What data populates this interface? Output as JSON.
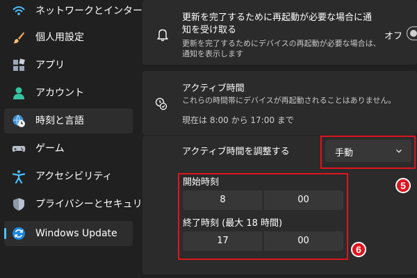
{
  "sidebar": {
    "items": [
      {
        "label": "ネットワークとインターネット",
        "icon": "wifi-icon"
      },
      {
        "label": "個人用設定",
        "icon": "brush-icon"
      },
      {
        "label": "アプリ",
        "icon": "apps-icon"
      },
      {
        "label": "アカウント",
        "icon": "account-icon"
      },
      {
        "label": "時刻と言語",
        "icon": "time-language-icon",
        "selected": true
      },
      {
        "label": "ゲーム",
        "icon": "gamepad-icon"
      },
      {
        "label": "アクセシビリティ",
        "icon": "accessibility-icon"
      },
      {
        "label": "プライバシーとセキュリティ",
        "icon": "shield-icon"
      },
      {
        "label": "Windows Update",
        "icon": "windows-update-icon",
        "selected": true
      }
    ]
  },
  "notify_card": {
    "title_line1": "更新を完了するために再起動が必要な場合に通",
    "title_line2": "知を受け取る",
    "desc_line1": "更新を完了するためにデバイスの再起動が必要な場合は、",
    "desc_line2": "通知を表示します",
    "toggle_label": "オフ",
    "toggle_on": false
  },
  "active_hours": {
    "title": "アクティブ時間",
    "desc": "これらの時間帯にデバイスが再起動されることはありません。",
    "current": "現在は 8:00 から 17:00 まで",
    "adjust_label": "アクティブ時間を調整する",
    "adjust_value": "手動",
    "start_label": "開始時刻",
    "start_hour": "8",
    "start_minute": "00",
    "end_label": "終了時刻 (最大 18 時間)",
    "end_hour": "17",
    "end_minute": "00"
  },
  "annotations": {
    "badge5": "5",
    "badge6": "6"
  },
  "colors": {
    "accent": "#4cc2ff",
    "highlight": "#e0141e",
    "background": "#202020",
    "card": "#2b2b2b"
  }
}
